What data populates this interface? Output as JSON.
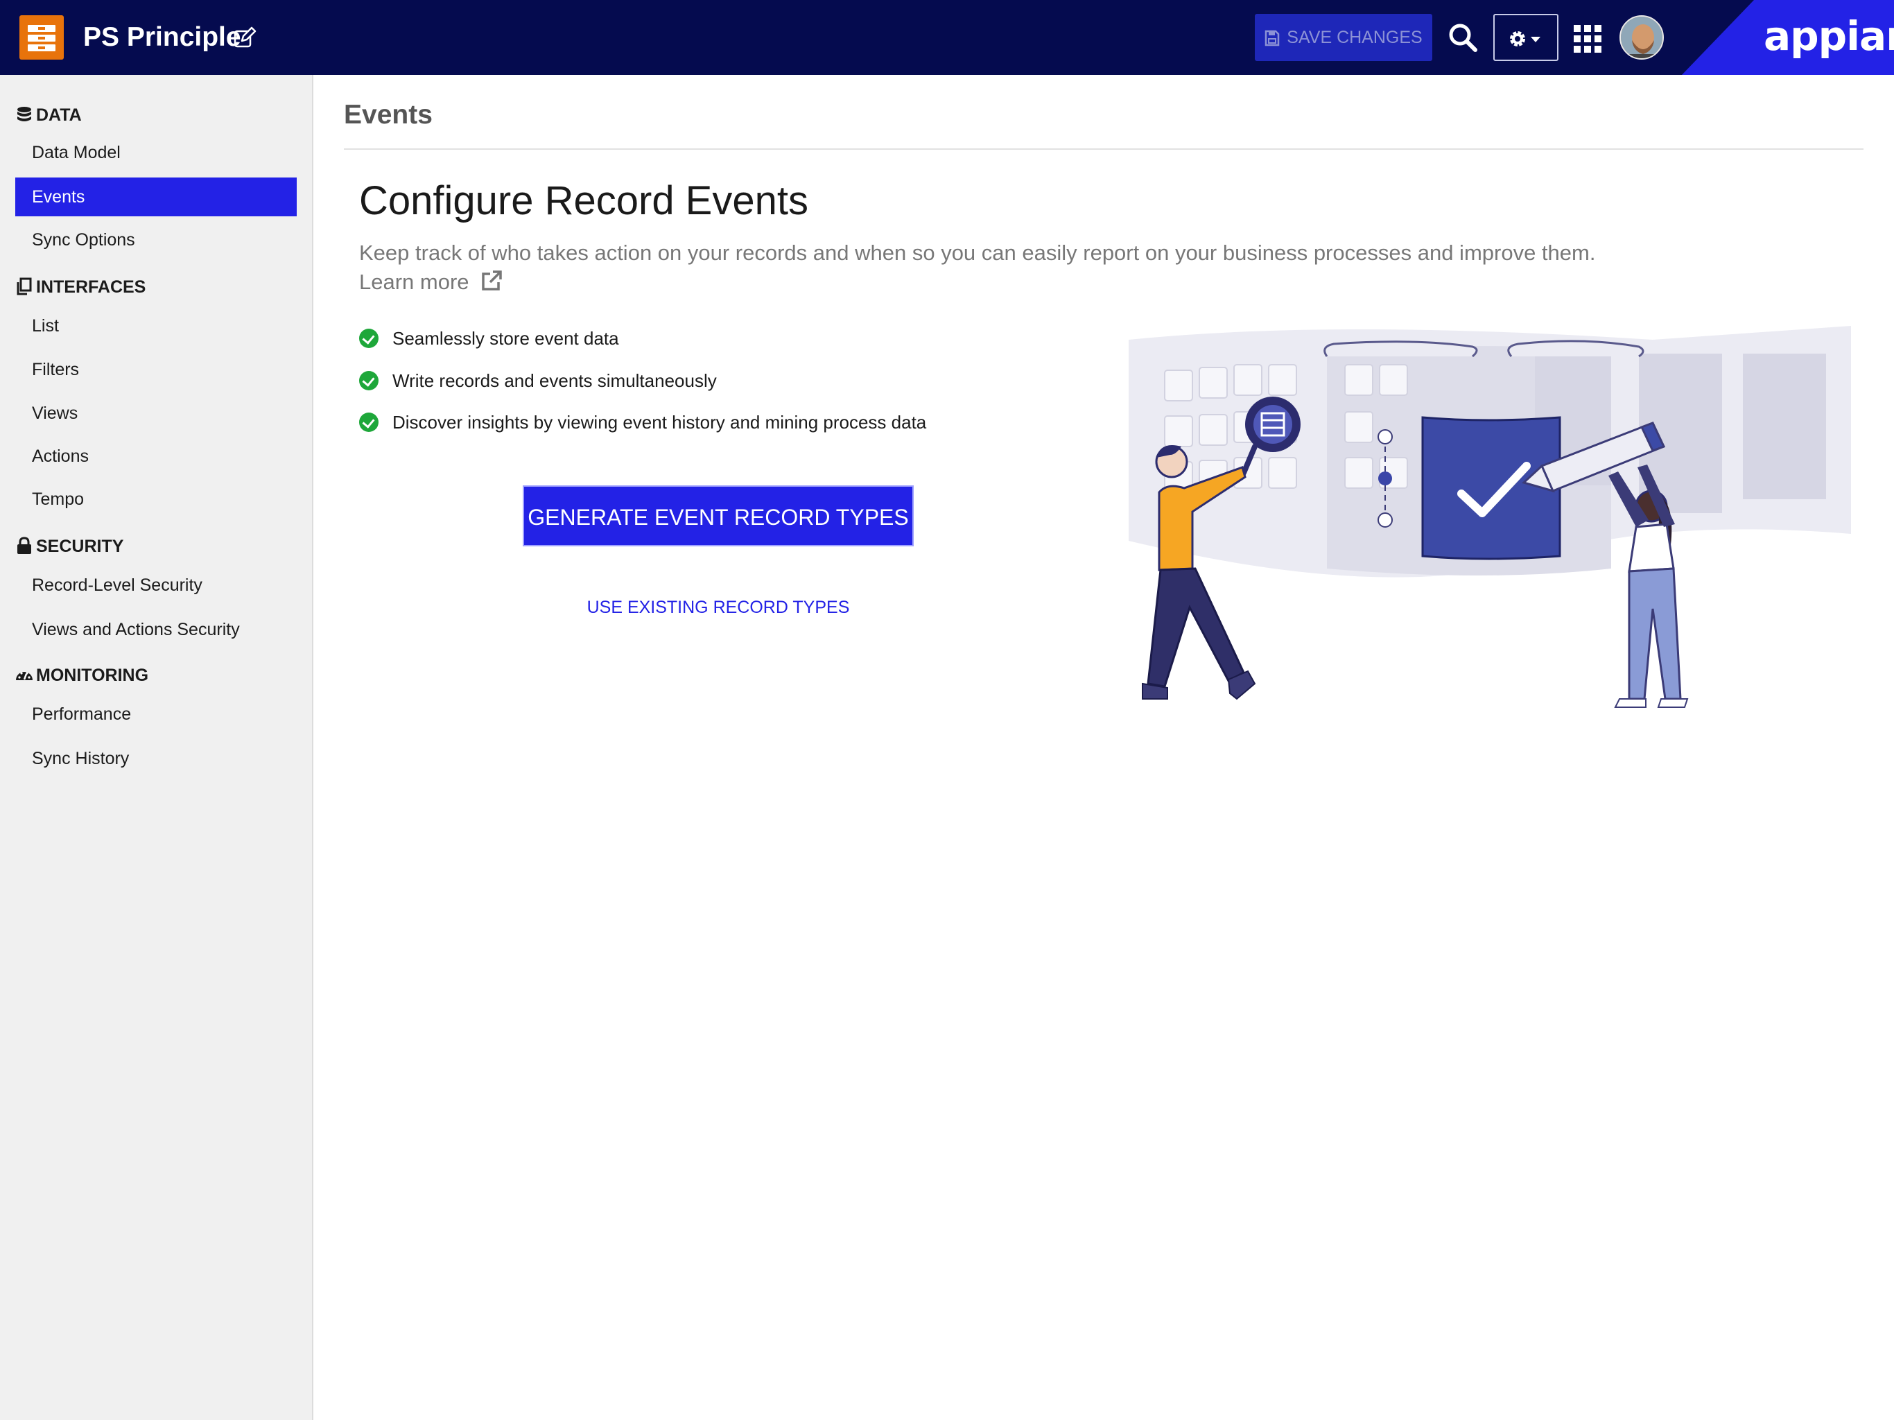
{
  "header": {
    "app_title": "PS Principle",
    "save_label": "SAVE CHANGES",
    "logo_text": "appian",
    "icons": [
      "app-drawer-icon",
      "edit-icon",
      "floppy-icon",
      "search-icon",
      "gear-icon",
      "caret-down-icon",
      "apps-grid-icon",
      "avatar"
    ]
  },
  "sidebar": {
    "sections": [
      {
        "label": "DATA",
        "icon": "database-icon",
        "items": [
          "Data Model",
          "Events",
          "Sync Options"
        ]
      },
      {
        "label": "INTERFACES",
        "icon": "copy-icon",
        "items": [
          "List",
          "Filters",
          "Views",
          "Actions",
          "Tempo"
        ]
      },
      {
        "label": "SECURITY",
        "icon": "lock-icon",
        "items": [
          "Record-Level Security",
          "Views and Actions Security"
        ]
      },
      {
        "label": "MONITORING",
        "icon": "dashboard-icon",
        "items": [
          "Performance",
          "Sync History"
        ]
      }
    ],
    "active_item": "Events"
  },
  "main": {
    "page_title": "Events",
    "heading": "Configure Record Events",
    "subtitle": "Keep track of who takes action on your records and when so you can easily report on your business processes and improve them.",
    "learn_more": "Learn more",
    "features": [
      "Seamlessly store event data",
      "Write records and events simultaneously",
      "Discover insights by viewing event history and mining process data"
    ],
    "primary_button": "GENERATE EVENT RECORD TYPES",
    "secondary_link": "USE EXISTING RECORD TYPES"
  },
  "colors": {
    "header_bg": "#050b4f",
    "accent": "#2322e6",
    "sidebar_bg": "#f0f0f0",
    "check_green": "#1ea73a",
    "app_icon": "#e8730b"
  }
}
